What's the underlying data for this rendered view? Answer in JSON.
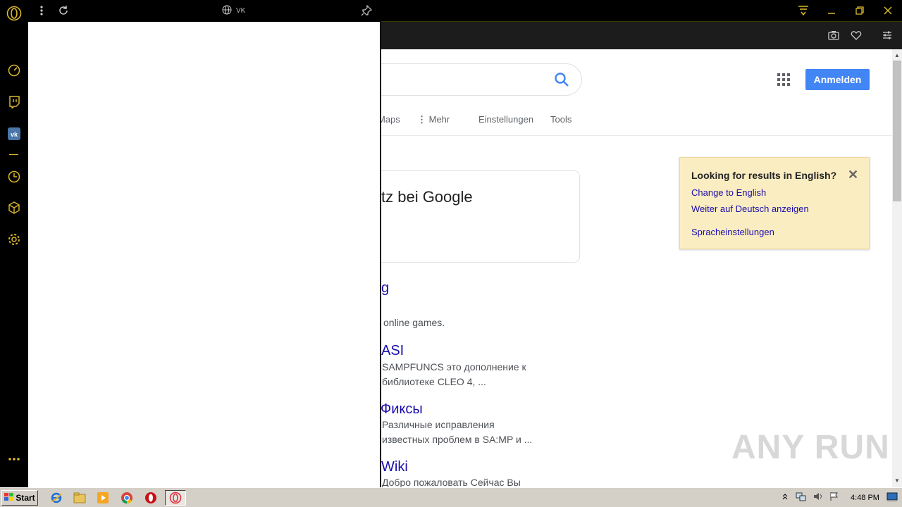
{
  "panel": {
    "title": "VK"
  },
  "google": {
    "nav": {
      "maps": "Maps",
      "more": "Mehr",
      "settings": "Einstellungen",
      "tools": "Tools"
    },
    "signin_label": "Anmelden",
    "card_title": "tz bei Google"
  },
  "lang_popup": {
    "title": "Looking for results in English?",
    "close": "✕",
    "change": "Change to English",
    "keep": "Weiter auf Deutsch anzeigen",
    "settings": "Spracheinstellungen"
  },
  "results": [
    {
      "title": "g",
      "snippet1": "online games.",
      "snippet2": ""
    },
    {
      "title": "ASI",
      "snippet1": "SAMPFUNCS это дополнение к",
      "snippet2": "библиотеке CLEO 4, ..."
    },
    {
      "title": "Фиксы",
      "snippet1": "Различные исправления",
      "snippet2": "известных проблем в SA:MP и ..."
    },
    {
      "title": "Wiki",
      "snippet1": "Добро пожаловать Сейчас Вы",
      "snippet2": ""
    }
  ],
  "watermark": "ANY RUN",
  "taskbar": {
    "start_label": "Start",
    "clock": "4:48 PM"
  },
  "colors": {
    "opera_accent": "#d9b82a",
    "google_blue": "#4285f4",
    "link": "#1a0dab",
    "popup_bg": "#fbedc2"
  }
}
